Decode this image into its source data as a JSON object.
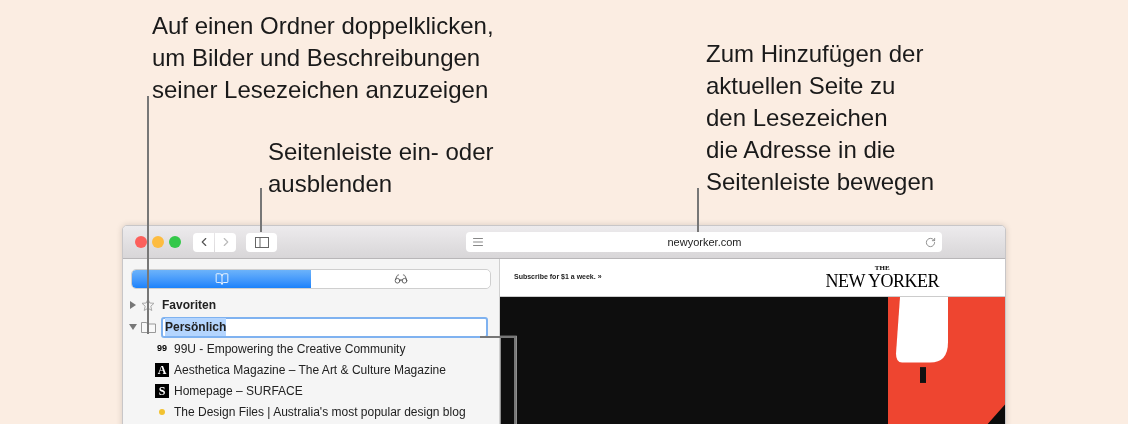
{
  "annotations": [
    {
      "text": "Auf einen Ordner doppelklicken,\num Bilder und Beschreibungen\nseiner Lesezeichen anzuzeigen"
    },
    {
      "text": "Seitenleiste ein- oder\nausblenden"
    },
    {
      "text": "Zum Hinzufügen der\naktuellen Seite zu\nden Lesezeichen\ndie Adresse in die\nSeitenleiste bewegen"
    }
  ],
  "toolbar": {
    "back_enabled": true,
    "forward_enabled": false,
    "address": "newyorker.com"
  },
  "sidebar": {
    "tabs": [
      {
        "kind": "bookmarks",
        "selected": true
      },
      {
        "kind": "reading-list",
        "selected": false
      }
    ],
    "tree": [
      {
        "kind": "favorites",
        "label": "Favoriten",
        "expanded": false,
        "editing": false
      },
      {
        "kind": "folder",
        "label": "Persönlich",
        "expanded": true,
        "editing": true,
        "children": [
          {
            "favicon": "99",
            "kind": "text-icon",
            "label": "99U - Empowering the Creative Community"
          },
          {
            "favicon": "A",
            "kind": "block-icon",
            "label": "Aesthetica Magazine – The Art & Culture Magazine"
          },
          {
            "favicon": "S",
            "kind": "block-icon",
            "label": "Homepage – SURFACE"
          },
          {
            "kind": "dot-icon",
            "color": "#f2c230",
            "label": "The Design Files | Australia's most popular design blog"
          }
        ]
      }
    ]
  },
  "page": {
    "subscribe": "Subscribe for $1 a week. »",
    "logo_small": "THE",
    "logo": "NEW YORKER"
  }
}
